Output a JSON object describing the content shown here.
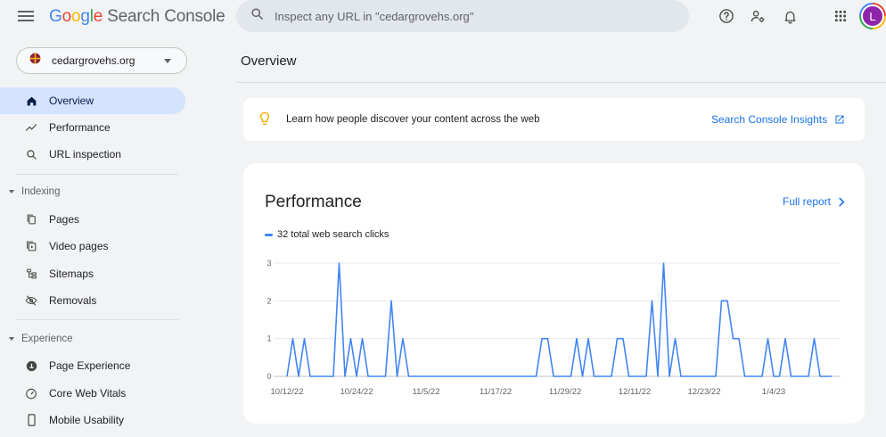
{
  "app": {
    "brand_google": [
      "G",
      "o",
      "o",
      "g",
      "l",
      "e"
    ],
    "brand_suffix": "Search Console"
  },
  "search": {
    "placeholder": "Inspect any URL in \"cedargrovehs.org\""
  },
  "topbar_icons": [
    "help-icon",
    "manage-users-icon",
    "notifications-bell-icon",
    "apps-grid-icon"
  ],
  "account": {
    "initial": "L",
    "color": "#8e24aa"
  },
  "property": {
    "name": "cedargrovehs.org"
  },
  "sidebar": {
    "items": [
      {
        "label": "Overview",
        "icon": "home-icon",
        "active": true
      },
      {
        "label": "Performance",
        "icon": "trend-icon"
      },
      {
        "label": "URL inspection",
        "icon": "search-icon"
      }
    ],
    "indexing": {
      "label": "Indexing",
      "items": [
        {
          "label": "Pages",
          "icon": "pages-icon"
        },
        {
          "label": "Video pages",
          "icon": "video-pages-icon"
        },
        {
          "label": "Sitemaps",
          "icon": "sitemaps-icon"
        },
        {
          "label": "Removals",
          "icon": "removals-icon"
        }
      ]
    },
    "experience": {
      "label": "Experience",
      "items": [
        {
          "label": "Page Experience",
          "icon": "page-experience-icon"
        },
        {
          "label": "Core Web Vitals",
          "icon": "gauge-icon"
        },
        {
          "label": "Mobile Usability",
          "icon": "phone-icon"
        }
      ]
    }
  },
  "main": {
    "title": "Overview",
    "banner": {
      "text": "Learn how people discover your content across the web",
      "link": "Search Console Insights"
    },
    "performance": {
      "title": "Performance",
      "full_report": "Full report",
      "legend": "32 total web search clicks"
    }
  },
  "colors": {
    "accent": "#1a73e8",
    "series": "#4285f4",
    "active_nav": "#d3e3fd"
  },
  "chart_data": {
    "type": "line",
    "series": [
      {
        "name": "32 total web search clicks",
        "values": [
          0,
          1,
          0,
          1,
          0,
          0,
          0,
          0,
          0,
          3,
          0,
          1,
          0,
          1,
          0,
          0,
          0,
          0,
          2,
          0,
          1,
          0,
          0,
          0,
          0,
          0,
          0,
          0,
          0,
          0,
          0,
          0,
          0,
          0,
          0,
          0,
          0,
          0,
          0,
          0,
          0,
          0,
          0,
          0,
          1,
          1,
          0,
          0,
          0,
          0,
          1,
          0,
          1,
          0,
          0,
          0,
          0,
          1,
          1,
          0,
          0,
          0,
          0,
          2,
          0,
          3,
          0,
          1,
          0,
          0,
          0,
          0,
          0,
          0,
          0,
          2,
          2,
          1,
          1,
          0,
          0,
          0,
          0,
          1,
          0,
          0,
          1,
          0,
          0,
          0,
          0,
          1,
          0,
          0,
          0
        ]
      }
    ],
    "x_tick_labels": [
      "10/12/22",
      "10/24/22",
      "11/5/22",
      "11/17/22",
      "11/29/22",
      "12/11/22",
      "12/23/22",
      "1/4/23"
    ],
    "y_ticks": [
      0,
      1,
      2,
      3
    ],
    "ylim": [
      0,
      3
    ],
    "grid": true
  }
}
